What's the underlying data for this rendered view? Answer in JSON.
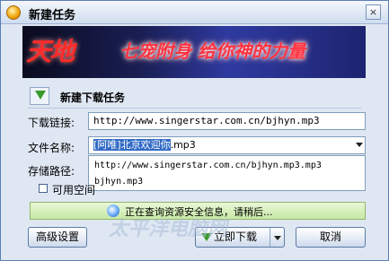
{
  "window": {
    "title": "新建任务",
    "close_label": "×"
  },
  "banner": {
    "logo_text": "天地",
    "slogan": "七宠附身 给你神的力量"
  },
  "section": {
    "title": "新建下载任务"
  },
  "form": {
    "url_label": "下载链接:",
    "url_value": "http://www.singerstar.com.cn/bjhyn.mp3",
    "filename_label": "文件名称:",
    "filename_selected": "[阿唯]北京欢迎你",
    "filename_rest": ".mp3",
    "save_label": "存储路径:",
    "dropdown_options": [
      "http://www.singerstar.com.cn/bjhyn.mp3.mp3",
      "bjhyn.mp3"
    ],
    "space_label": "可用空间"
  },
  "status": {
    "text": "正在查询资源安全信息，请稍后..."
  },
  "buttons": {
    "advanced": "高级设置",
    "download_now": "立即下载",
    "cancel": "取消"
  },
  "watermark": "太平洋电脑网",
  "icons": {
    "title": "app-logo-icon",
    "section": "download-arrow-icon",
    "close": "close-icon",
    "status": "shield-icon",
    "download": "download-arrow-icon",
    "dropdown": "chevron-down-icon"
  },
  "colors": {
    "selection": "#316ac5",
    "status_bg": "#c7e8a6",
    "slogan": "#ff3340",
    "download_arrow": "#3a9a2c"
  }
}
